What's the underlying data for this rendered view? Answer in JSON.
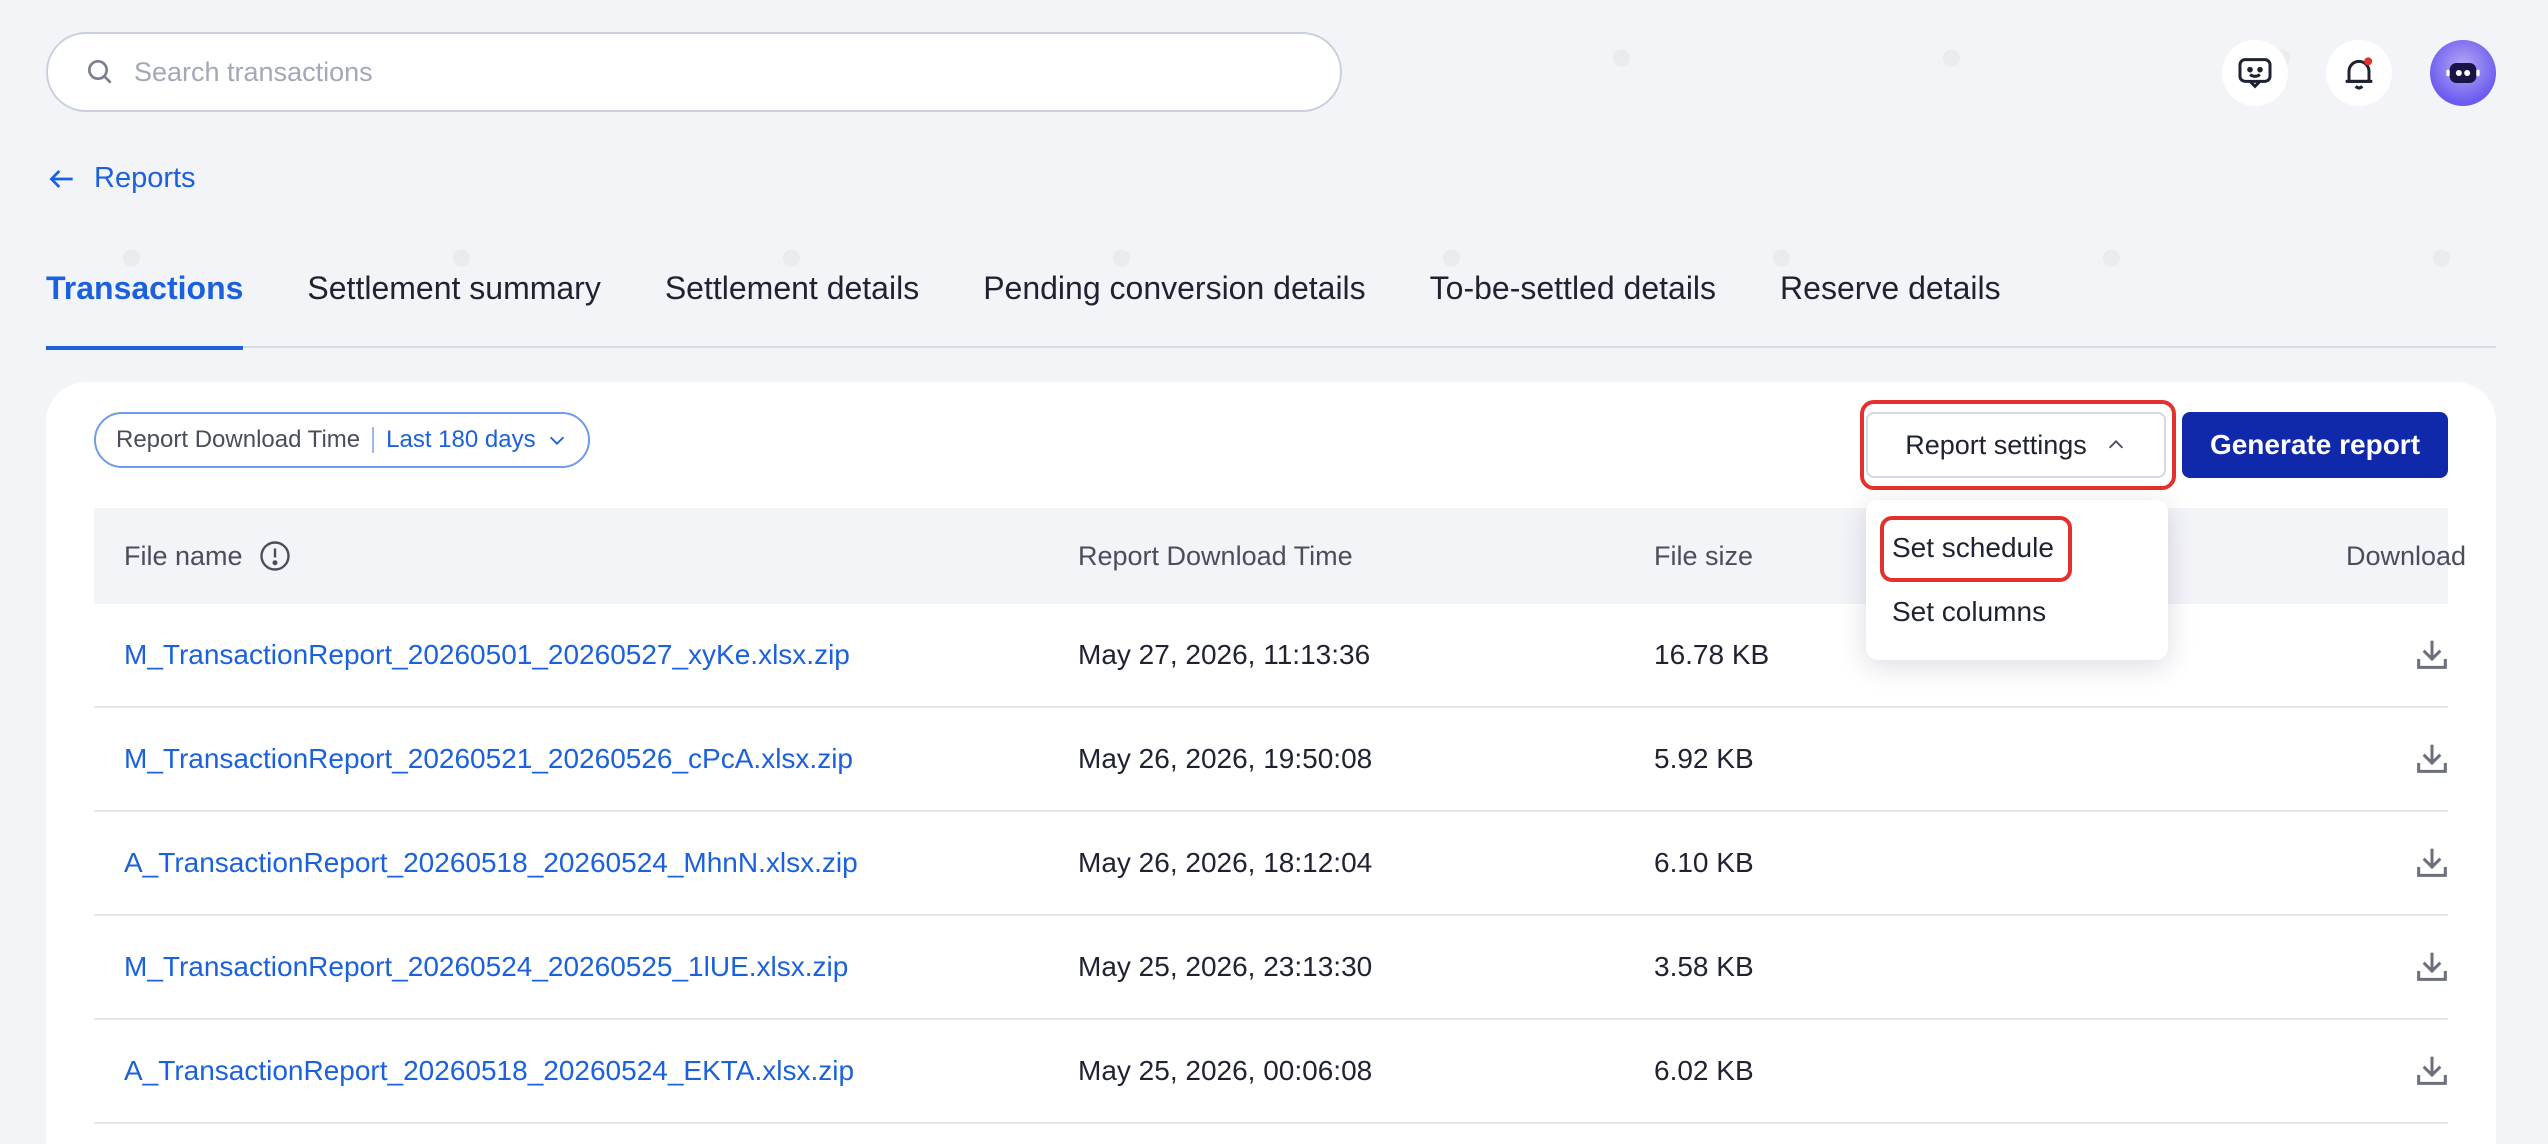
{
  "search": {
    "placeholder": "Search transactions"
  },
  "breadcrumb": {
    "label": "Reports"
  },
  "tabs": [
    {
      "label": "Transactions",
      "active": true
    },
    {
      "label": "Settlement summary"
    },
    {
      "label": "Settlement details"
    },
    {
      "label": "Pending conversion details"
    },
    {
      "label": "To-be-settled details"
    },
    {
      "label": "Reserve details"
    }
  ],
  "filter": {
    "label": "Report Download Time",
    "value": "Last 180 days"
  },
  "toolbar": {
    "settings_label": "Report settings",
    "generate_label": "Generate report"
  },
  "dropdown": {
    "items": [
      "Set schedule",
      "Set columns"
    ]
  },
  "table": {
    "headers": [
      "File name",
      "Report Download Time",
      "File size",
      "Download"
    ],
    "rows": [
      {
        "file": "M_TransactionReport_20260501_20260527_xyKe.xlsx.zip",
        "time": "May 27, 2026, 11:13:36",
        "size": "16.78 KB"
      },
      {
        "file": "M_TransactionReport_20260521_20260526_cPcA.xlsx.zip",
        "time": "May 26, 2026, 19:50:08",
        "size": "5.92 KB"
      },
      {
        "file": "A_TransactionReport_20260518_20260524_MhnN.xlsx.zip",
        "time": "May 26, 2026, 18:12:04",
        "size": "6.10 KB"
      },
      {
        "file": "M_TransactionReport_20260524_20260525_1lUE.xlsx.zip",
        "time": "May 25, 2026, 23:13:30",
        "size": "3.58 KB"
      },
      {
        "file": "A_TransactionReport_20260518_20260524_EKTA.xlsx.zip",
        "time": "May 25, 2026, 00:06:08",
        "size": "6.02 KB"
      }
    ]
  },
  "colors": {
    "accent": "#1a61db",
    "primary_button": "#0f29aa",
    "highlight": "#e3312d",
    "background": "#f3f4f8"
  },
  "icons": [
    "search-icon",
    "feedback-icon",
    "bell-icon",
    "avatar-robot-icon",
    "arrow-left-icon",
    "chevron-down-icon",
    "chevron-up-icon",
    "info-icon",
    "download-icon"
  ]
}
